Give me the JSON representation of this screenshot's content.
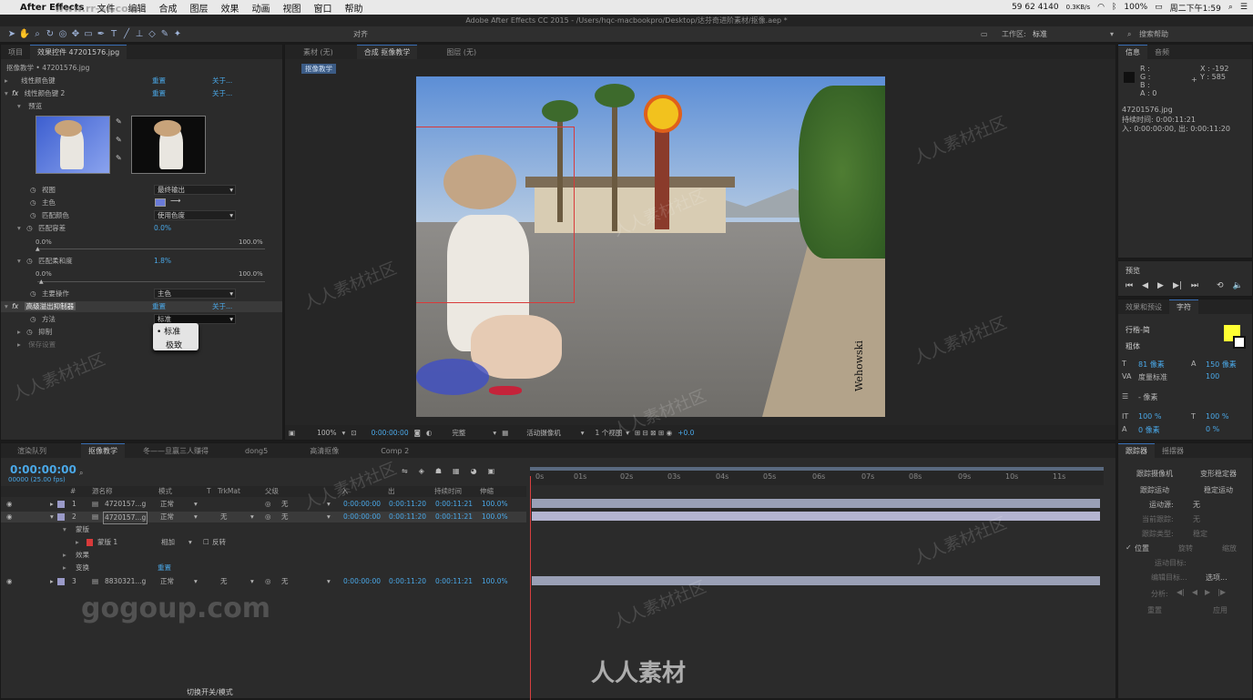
{
  "menubar": {
    "app": "After Effects",
    "items": [
      "文件",
      "编辑",
      "合成",
      "图层",
      "效果",
      "动画",
      "视图",
      "窗口",
      "帮助"
    ],
    "wm_url": "www.rr-sc.com",
    "stock": "59 62 4140",
    "net": "0.3KB/s",
    "battery": "100%",
    "clock": "周二下午1:59"
  },
  "window_title": "Adobe After Effects CC 2015 - /Users/hqc-macbookpro/Desktop/达芬奇进阶素材/抠像.aep *",
  "toolbar": {
    "align": "对齐",
    "workspace_label": "工作区:",
    "workspace_value": "标准",
    "search": "搜索帮助"
  },
  "left_panel": {
    "tabs": [
      "项目",
      "效果控件 47201576.jpg"
    ],
    "breadcrumb": "抠像教学 • 47201576.jpg",
    "rows": [
      {
        "label": "线性颜色键",
        "reset": "重置",
        "about": "关于..."
      },
      {
        "label": "线性颜色键 2",
        "reset": "重置",
        "about": "关于..."
      },
      {
        "label": "预览"
      },
      {
        "label": "视图",
        "value": "最终输出"
      },
      {
        "label": "主色"
      },
      {
        "label": "匹配颜色",
        "value": "使用色度"
      },
      {
        "label": "匹配容差",
        "value": "0.0%"
      },
      {
        "label": "匹配柔和度",
        "value": "1.8%"
      },
      {
        "label": "主要操作",
        "value": "主色"
      },
      {
        "label": "高级溢出抑制器",
        "reset": "重置",
        "about": "关于..."
      },
      {
        "label": "方法",
        "value": "标准"
      },
      {
        "label": "抑制"
      },
      {
        "label": "保存设置"
      }
    ],
    "slider_min": "0.0%",
    "slider_max": "100.0%",
    "popup": [
      "标准",
      "极致"
    ]
  },
  "comp_panel": {
    "tabs": [
      "素材 (无)",
      "合成 抠像教学",
      "图层 (无)"
    ],
    "comp_label": "抠像教学",
    "signature": "Wehowski",
    "bottom": {
      "zoom": "100%",
      "time": "0:00:00:00",
      "quality": "完整",
      "camera": "活动摄像机",
      "views": "1 个视图",
      "offset": "+0.0"
    }
  },
  "info_panel": {
    "tabs": [
      "信息",
      "音频"
    ],
    "r": "R :",
    "g": "G :",
    "b": "B :",
    "a": "A : 0",
    "x": "X : -192",
    "y": "Y : 585",
    "file": "47201576.jpg",
    "duration": "持续时间: 0:00:11:21",
    "inout": "入: 0:00:00:00, 出: 0:00:11:20"
  },
  "preview_panel": {
    "title": "预览"
  },
  "char_panel": {
    "tabs": [
      "效果和预设",
      "字符"
    ],
    "font": "行楷-简",
    "style": "粗体",
    "size": "81 像素",
    "leading": "150 像素",
    "kerning": "度量标准",
    "tracking": "100",
    "indent": "- 像素",
    "vscale": "100 %",
    "hscale": "100 %",
    "baseline": "0 像素",
    "tsume": "0 %",
    "fill_color": "#ffff33"
  },
  "timeline": {
    "tabs": [
      "渲染队列",
      "抠像教学",
      "冬——旦赢三人赚得",
      "dong5",
      "高清抠像",
      "Comp 2"
    ],
    "timecode": "0:00:00:00",
    "fps": "00000 (25.00 fps)",
    "cols": [
      "#",
      "源名称",
      "模式",
      "T",
      "TrkMat",
      "父级",
      "入",
      "出",
      "持续时间",
      "伸缩"
    ],
    "layers": [
      {
        "num": "1",
        "name": "4720157...g",
        "mode": "正常",
        "trk": "",
        "parent": "无",
        "in": "0:00:00:00",
        "out": "0:00:11:20",
        "dur": "0:00:11:21",
        "stretch": "100.0%"
      },
      {
        "num": "2",
        "name": "4720157...g",
        "mode": "正常",
        "trk": "无",
        "parent": "无",
        "in": "0:00:00:00",
        "out": "0:00:11:20",
        "dur": "0:00:11:21",
        "stretch": "100.0%"
      },
      {
        "num": "3",
        "name": "8830321...g",
        "mode": "正常",
        "trk": "无",
        "parent": "无",
        "in": "0:00:00:00",
        "out": "0:00:11:20",
        "dur": "0:00:11:21",
        "stretch": "100.0%"
      }
    ],
    "sub": {
      "masks": "蒙版",
      "mask1": "蒙版 1",
      "mask_mode": "相加",
      "invert": "反转",
      "effects": "效果",
      "transform": "变换",
      "reset": "重置"
    },
    "ruler": [
      "0s",
      "01s",
      "02s",
      "03s",
      "04s",
      "05s",
      "06s",
      "07s",
      "08s",
      "09s",
      "10s",
      "11s"
    ],
    "footer": "切换开关/模式"
  },
  "tracker_panel": {
    "tabs": [
      "跟踪器",
      "摇摆器"
    ],
    "buttons": [
      "跟踪摄像机",
      "变形稳定器",
      "跟踪运动",
      "稳定运动"
    ],
    "source_label": "运动源:",
    "source_value": "无",
    "current_track": "当前跟踪:",
    "current_value": "无",
    "track_type": "跟踪类型:",
    "track_type_value": "稳定",
    "checks": [
      "位置",
      "旋转",
      "缩放"
    ],
    "motion_target": "运动目标:",
    "edit_target": "编辑目标...",
    "options": "选项...",
    "analyze": "分析:",
    "reset": "重置",
    "apply": "应用"
  },
  "watermarks": {
    "logo": "gogoup.com",
    "brand": "人人素材",
    "repeat": "人人素材社区"
  }
}
